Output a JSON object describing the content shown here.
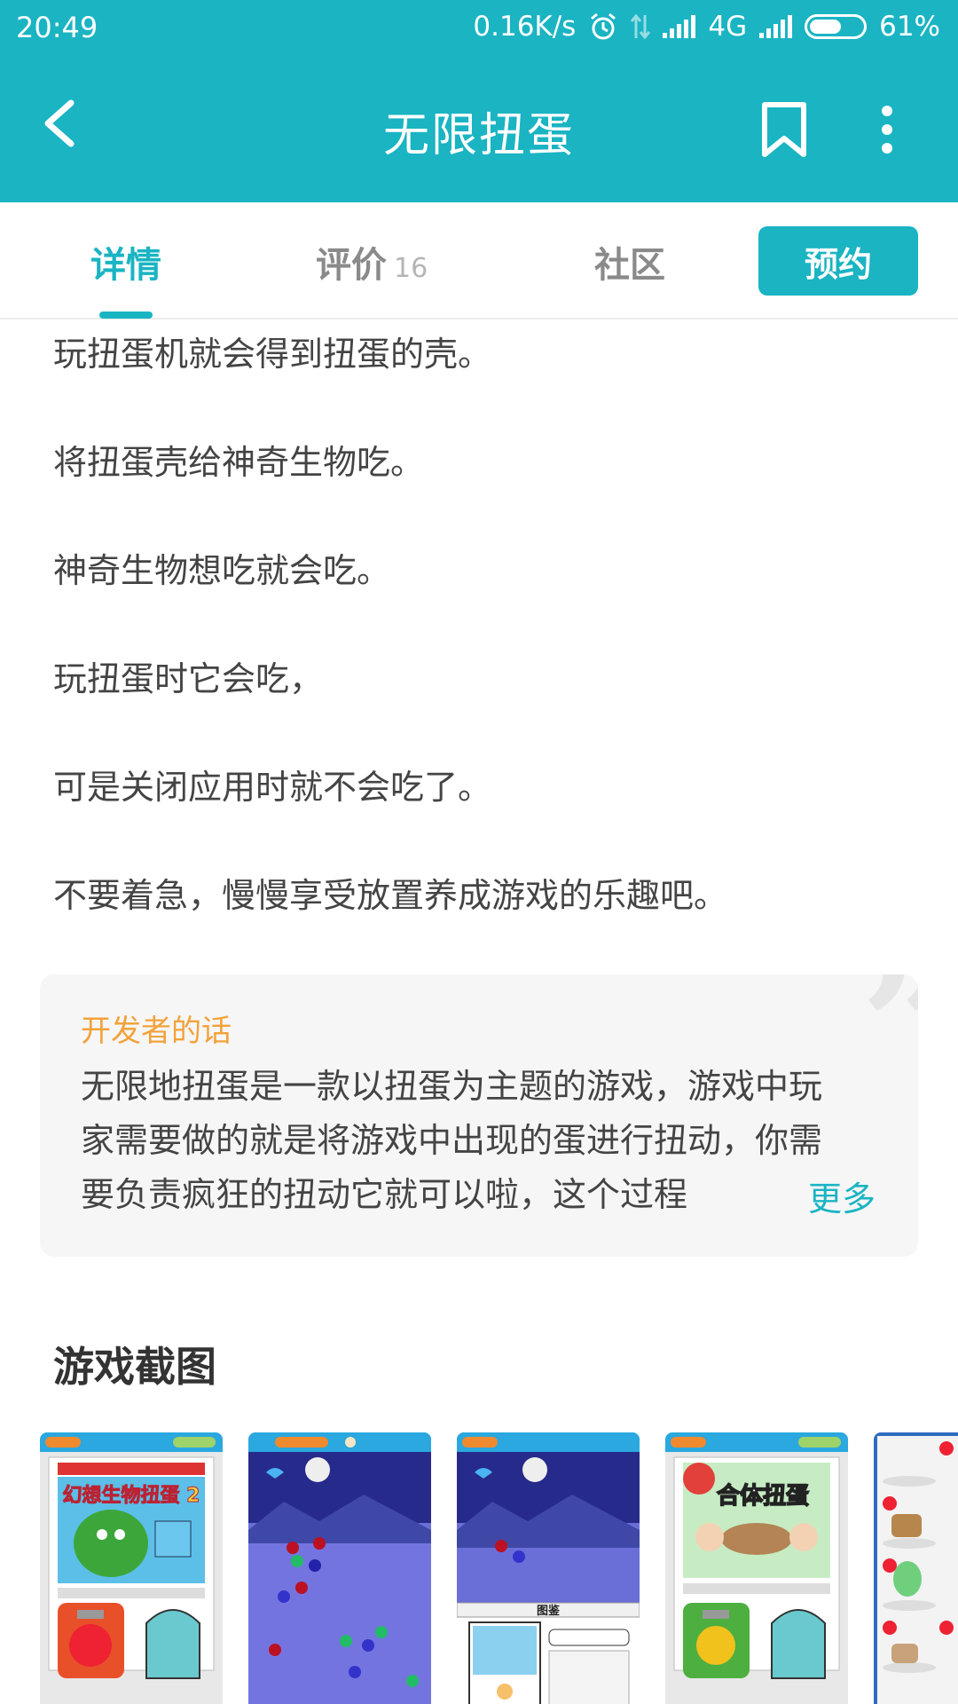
{
  "status": {
    "time": "20:49",
    "net_speed": "0.16K/s",
    "network": "4G",
    "battery": "61%",
    "battery_level": 0.61
  },
  "header": {
    "title": "无限扭蛋"
  },
  "tabs": {
    "details": "详情",
    "reviews": "评价",
    "reviews_count": "16",
    "community": "社区",
    "reserve": "预约"
  },
  "description": [
    "玩扭蛋机就会得到扭蛋的壳。",
    "将扭蛋壳给神奇生物吃。",
    "神奇生物想吃就会吃。",
    "玩扭蛋时它会吃，",
    "可是关闭应用时就不会吃了。",
    "不要着急，慢慢享受放置养成游戏的乐趣吧。"
  ],
  "developer": {
    "title": "开发者的话",
    "text": "无限地扭蛋是一款以扭蛋为主题的游戏，游戏中玩家需要做的就是将游戏中出现的蛋进行扭动，你需要负责疯狂的扭动它就可以啦，这个过程",
    "more": "更多"
  },
  "screenshots": {
    "title": "游戏截图",
    "items": [
      {
        "caption": "幻想生物扭蛋 2"
      },
      {
        "caption": ""
      },
      {
        "caption": "图鉴"
      },
      {
        "caption": "合体扭蛋"
      },
      {
        "caption": ""
      }
    ]
  },
  "colors": {
    "accent": "#1ab4c3",
    "developer_title": "#f3a23b",
    "card_background": "#f6f6f6"
  }
}
